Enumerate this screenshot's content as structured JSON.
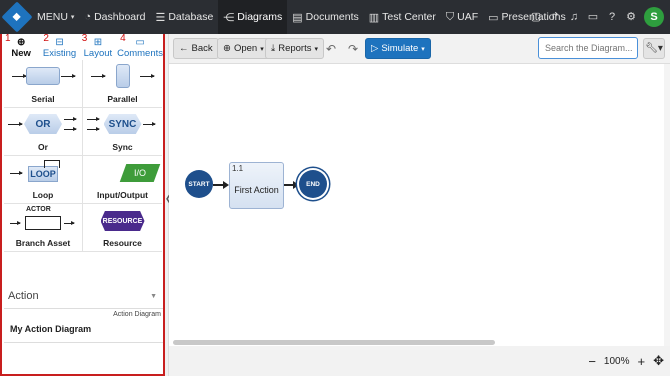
{
  "topbar": {
    "menu_label": "MENU",
    "nav": [
      {
        "label": "Dashboard"
      },
      {
        "label": "Database"
      },
      {
        "label": "Diagrams"
      },
      {
        "label": "Documents"
      },
      {
        "label": "Test Center"
      },
      {
        "label": "UAF"
      },
      {
        "label": "Presentations"
      }
    ],
    "avatar_initial": "S"
  },
  "left_panel": {
    "tabs": [
      {
        "num": "1",
        "label": "New"
      },
      {
        "num": "2",
        "label": "Existing"
      },
      {
        "num": "3",
        "label": "Layout"
      },
      {
        "num": "4",
        "label": "Comments"
      }
    ],
    "palette": [
      {
        "label": "Serial"
      },
      {
        "label": "Parallel"
      },
      {
        "label": "Or",
        "shape_text": "OR"
      },
      {
        "label": "Sync",
        "shape_text": "SYNC"
      },
      {
        "label": "Loop",
        "shape_text": "LOOP"
      },
      {
        "label": "Input/Output",
        "shape_text": "I/O"
      },
      {
        "label": "Branch Asset",
        "shape_text": "ACTOR"
      },
      {
        "label": "Resource",
        "shape_text": "RESOURCE"
      }
    ],
    "type_select": "Action",
    "diagram_type": "Action Diagram",
    "diagram_name": "My Action Diagram"
  },
  "toolbar": {
    "back": "Back",
    "open": "Open",
    "reports": "Reports",
    "simulate": "Simulate",
    "search_placeholder": "Search the Diagram..."
  },
  "canvas": {
    "start_label": "START",
    "end_label": "END",
    "node": {
      "number": "1.1",
      "name": "First Action"
    }
  },
  "status": {
    "zoom": "100%"
  },
  "colors": {
    "accent": "#1e73be",
    "topbar": "#2b2e33",
    "highlight_border": "#c81e1e"
  }
}
